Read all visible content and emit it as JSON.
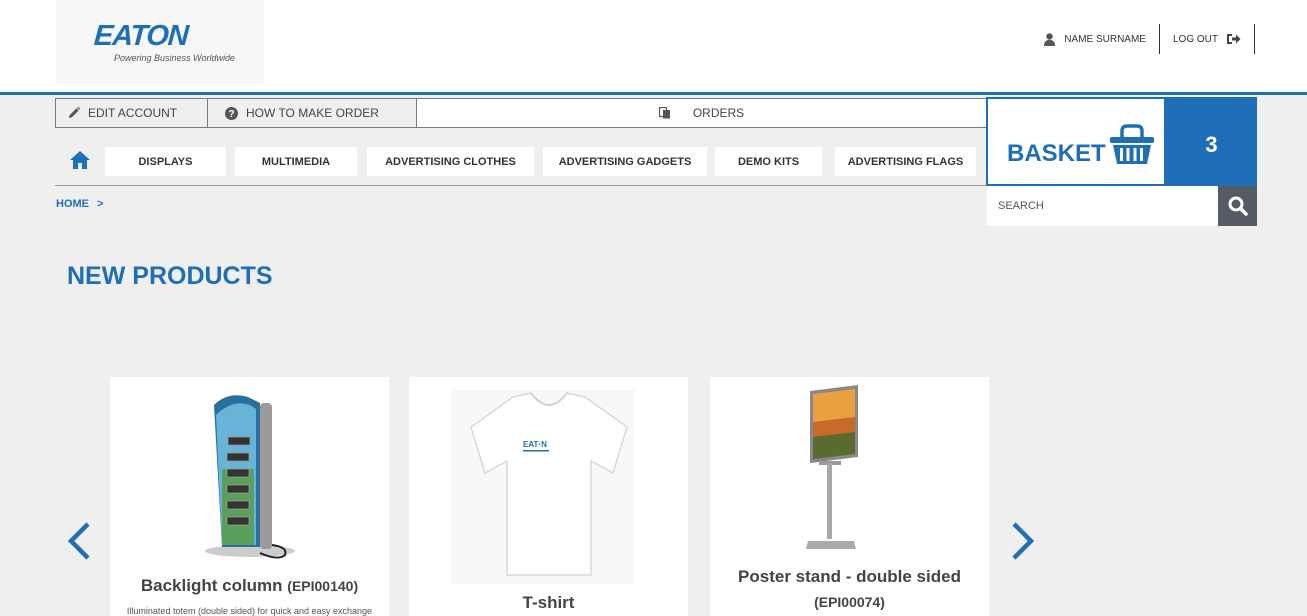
{
  "brand": {
    "logo_text": "EATON",
    "tagline": "Powering Business Worldwide",
    "accent_color": "#1f6fb8"
  },
  "user_bar": {
    "user_name": "NAME SURNAME",
    "logout_label": "LOG OUT",
    "user_icon": "user-icon",
    "logout_icon": "logout-icon"
  },
  "account_nav": {
    "edit_account": "EDIT ACCOUNT",
    "how_to_order": "HOW TO MAKE ORDER",
    "orders": "ORDERS"
  },
  "categories": [
    "DISPLAYS",
    "MULTIMEDIA",
    "ADVERTISING CLOTHES",
    "ADVERTISING GADGETS",
    "DEMO KITS",
    "ADVERTISING FLAGS"
  ],
  "basket": {
    "label": "BASKET",
    "count": "3"
  },
  "search": {
    "placeholder": "SEARCH"
  },
  "breadcrumb": {
    "home": "HOME",
    "separator": ">"
  },
  "page_title": "NEW PRODUCTS",
  "products": [
    {
      "name": "Backlight column",
      "code": "(EPI00140)",
      "description": "Illuminated totem (double sided) for quick and easy exchange"
    },
    {
      "name": "T-shirt",
      "code": "",
      "description": ""
    },
    {
      "name": "Poster stand  - double sided",
      "code": "(EPI00074)",
      "description": ""
    }
  ]
}
